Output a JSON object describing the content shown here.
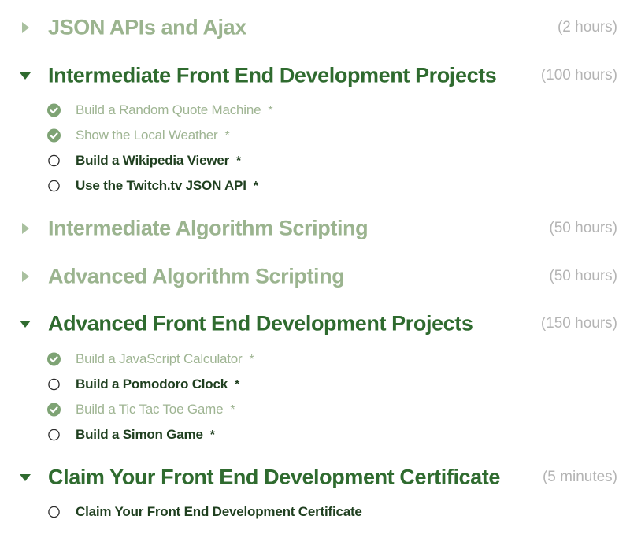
{
  "sections": [
    {
      "title": "JSON APIs and Ajax",
      "hours": "(2 hours)",
      "state": "collapsed"
    },
    {
      "title": "Intermediate Front End Development Projects",
      "hours": "(100 hours)",
      "state": "expanded",
      "challenges": [
        {
          "label": "Build a Random Quote Machine",
          "star": "*",
          "done": true
        },
        {
          "label": "Show the Local Weather",
          "star": "*",
          "done": true
        },
        {
          "label": "Build a Wikipedia Viewer",
          "star": "*",
          "done": false
        },
        {
          "label": "Use the Twitch.tv JSON API",
          "star": "*",
          "done": false
        }
      ]
    },
    {
      "title": "Intermediate Algorithm Scripting",
      "hours": "(50 hours)",
      "state": "collapsed"
    },
    {
      "title": "Advanced Algorithm Scripting",
      "hours": "(50 hours)",
      "state": "collapsed"
    },
    {
      "title": "Advanced Front End Development Projects",
      "hours": "(150 hours)",
      "state": "expanded",
      "challenges": [
        {
          "label": "Build a JavaScript Calculator",
          "star": "*",
          "done": true
        },
        {
          "label": "Build a Pomodoro Clock",
          "star": "*",
          "done": false
        },
        {
          "label": "Build a Tic Tac Toe Game",
          "star": "*",
          "done": true
        },
        {
          "label": "Build a Simon Game",
          "star": "*",
          "done": false
        }
      ]
    },
    {
      "title": "Claim Your Front End Development Certificate",
      "hours": "(5 minutes)",
      "state": "expanded",
      "challenges": [
        {
          "label": "Claim Your Front End Development Certificate",
          "star": "",
          "done": false
        }
      ]
    }
  ],
  "icons": {
    "collapsed_arrow": "caret-right-icon",
    "expanded_arrow": "caret-down-icon",
    "done_status": "check-circle-icon",
    "todo_status": "empty-circle-icon"
  },
  "colors": {
    "expanded_title": "#2f6b2f",
    "collapsed_title": "#9bb48f",
    "todo_label": "#1f3f1f",
    "done_label": "#9fb593",
    "hours": "#b4b4b4",
    "check_fill": "#7ea374"
  }
}
